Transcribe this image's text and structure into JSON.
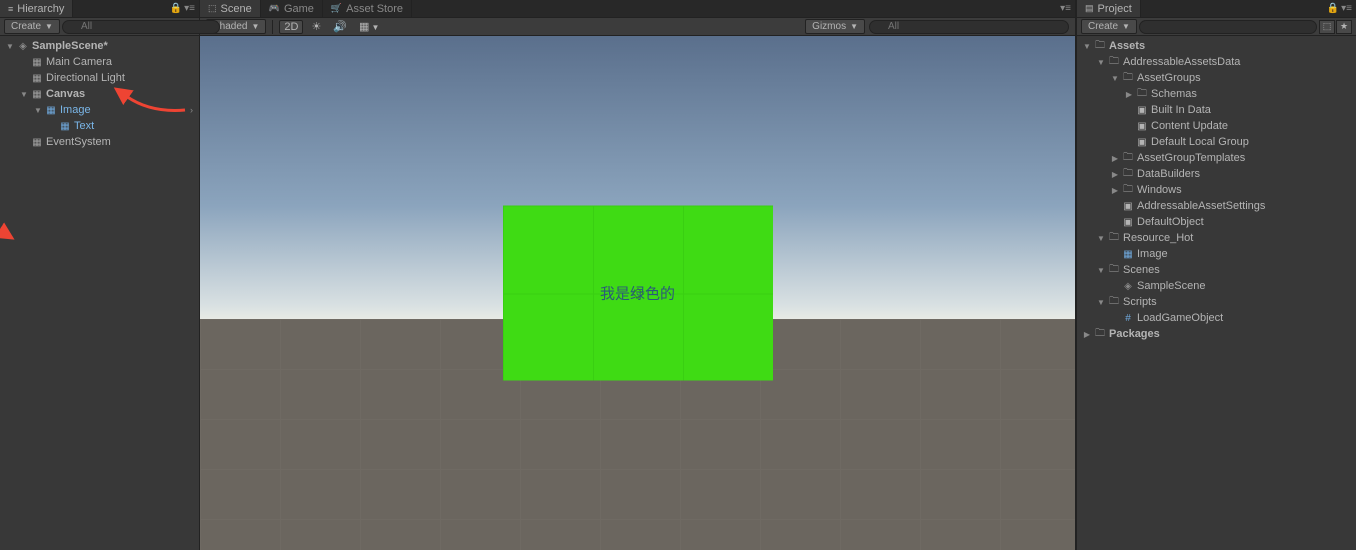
{
  "hierarchy": {
    "tab_label": "Hierarchy",
    "create_label": "Create",
    "search_placeholder": "All",
    "items": [
      {
        "label": "SampleScene*",
        "icon": "unity",
        "expanded": true
      },
      {
        "label": "Main Camera",
        "icon": "go"
      },
      {
        "label": "Directional Light",
        "icon": "go"
      },
      {
        "label": "Canvas",
        "icon": "go",
        "expanded": true
      },
      {
        "label": "Image",
        "icon": "go",
        "expanded": true
      },
      {
        "label": "Text",
        "icon": "go"
      },
      {
        "label": "EventSystem",
        "icon": "go"
      }
    ]
  },
  "center": {
    "tabs": {
      "scene": "Scene",
      "game": "Game",
      "asset_store": "Asset Store"
    },
    "toolbar": {
      "shaded": "Shaded",
      "twod": "2D",
      "gizmos": "Gizmos",
      "search_placeholder": "All"
    },
    "green_text": "我是绿色的"
  },
  "project": {
    "tab_label": "Project",
    "create_label": "Create",
    "search_placeholder": "",
    "tree": {
      "assets": "Assets",
      "addressable_assets_data": "AddressableAssetsData",
      "asset_groups": "AssetGroups",
      "schemas": "Schemas",
      "built_in_data": "Built In Data",
      "content_update": "Content Update",
      "default_local_group": "Default Local Group",
      "asset_group_templates": "AssetGroupTemplates",
      "data_builders": "DataBuilders",
      "windows": "Windows",
      "addressable_asset_settings": "AddressableAssetSettings",
      "default_object": "DefaultObject",
      "resource_hot": "Resource_Hot",
      "image": "Image",
      "scenes": "Scenes",
      "sample_scene": "SampleScene",
      "scripts": "Scripts",
      "load_game_object": "LoadGameObject",
      "packages": "Packages"
    }
  }
}
